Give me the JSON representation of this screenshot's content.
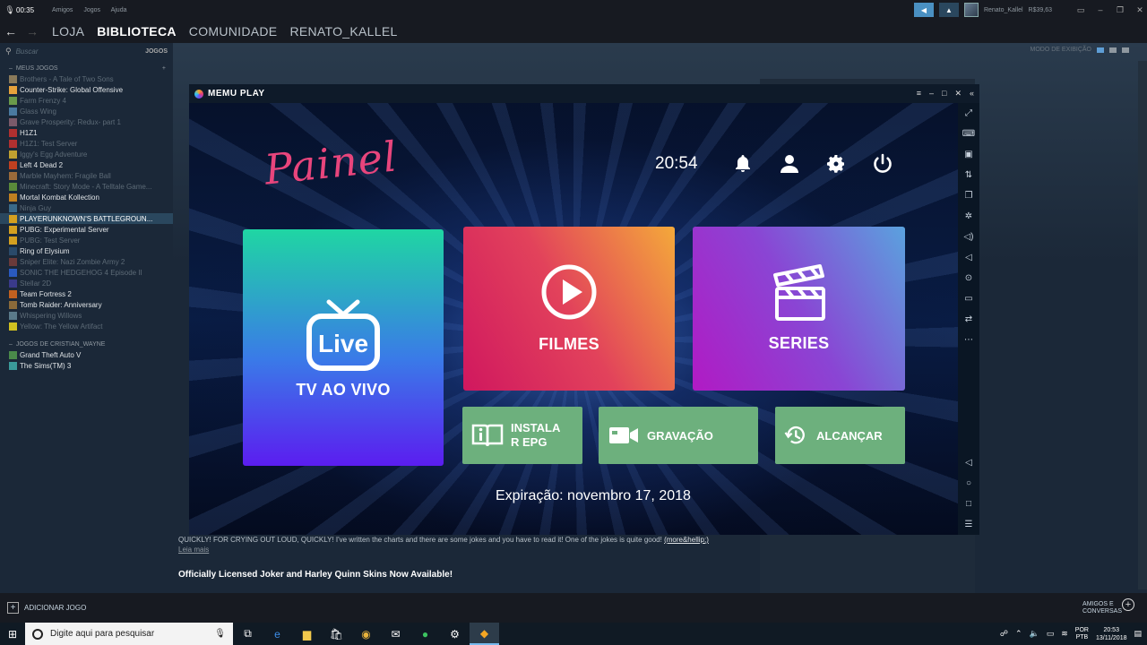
{
  "titlebar": {
    "clock": "00:35",
    "menu": [
      "Amigos",
      "Jogos",
      "Ajuda"
    ],
    "username": "Renato_Kallel",
    "wallet": "R$39,63"
  },
  "nav": {
    "items": [
      "LOJA",
      "BIBLIOTECA",
      "COMUNIDADE",
      "RENATO_KALLEL"
    ],
    "active": "BIBLIOTECA"
  },
  "sidebar": {
    "search_placeholder": "Buscar",
    "games_label": "JOGOS",
    "group1": "MEUS JOGOS",
    "games": [
      {
        "name": "Brothers - A Tale of Two Sons",
        "installed": false,
        "color": "#8a7a5a"
      },
      {
        "name": "Counter-Strike: Global Offensive",
        "installed": true,
        "color": "#e6a23c"
      },
      {
        "name": "Farm Frenzy 4",
        "installed": false,
        "color": "#6a9a4a"
      },
      {
        "name": "Glass Wing",
        "installed": false,
        "color": "#4a7aa0"
      },
      {
        "name": "Grave Prosperity: Redux- part 1",
        "installed": false,
        "color": "#7a5a6a"
      },
      {
        "name": "H1Z1",
        "installed": true,
        "color": "#b03030"
      },
      {
        "name": "H1Z1: Test Server",
        "installed": false,
        "color": "#b03030"
      },
      {
        "name": "Iggy's Egg Adventure",
        "installed": false,
        "color": "#c0a030"
      },
      {
        "name": "Left 4 Dead 2",
        "installed": true,
        "color": "#c04020"
      },
      {
        "name": "Marble Mayhem: Fragile Ball",
        "installed": false,
        "color": "#9a6a3a"
      },
      {
        "name": "Minecraft: Story Mode - A Telltale Game...",
        "installed": false,
        "color": "#5a8a3a"
      },
      {
        "name": "Mortal Kombat Kollection",
        "installed": true,
        "color": "#c08020"
      },
      {
        "name": "Ninja Guy",
        "installed": false,
        "color": "#3a6a8a"
      },
      {
        "name": "PLAYERUNKNOWN'S BATTLEGROUN...",
        "installed": true,
        "color": "#d4a020",
        "selected": true
      },
      {
        "name": "PUBG: Experimental Server",
        "installed": true,
        "color": "#d4a020"
      },
      {
        "name": "PUBG: Test Server",
        "installed": false,
        "color": "#d4a020"
      },
      {
        "name": "Ring of Elysium",
        "installed": true,
        "color": "#2a4a6a"
      },
      {
        "name": "Sniper Elite: Nazi Zombie Army 2",
        "installed": false,
        "color": "#6a3a3a"
      },
      {
        "name": "SONIC THE HEDGEHOG 4 Episode II",
        "installed": false,
        "color": "#2a5ac0"
      },
      {
        "name": "Stellar 2D",
        "installed": false,
        "color": "#3a3a8a"
      },
      {
        "name": "Team Fortress 2",
        "installed": true,
        "color": "#c06020"
      },
      {
        "name": "Tomb Raider: Anniversary",
        "installed": true,
        "color": "#8a6a3a"
      },
      {
        "name": "Whispering Willows",
        "installed": false,
        "color": "#5a7a8a"
      },
      {
        "name": "Yellow: The Yellow Artifact",
        "installed": false,
        "color": "#d0c020"
      }
    ],
    "group2": "JOGOS DE CRISTIAN_WAYNE",
    "games2": [
      {
        "name": "Grand Theft Auto V",
        "installed": true,
        "color": "#4a8a4a"
      },
      {
        "name": "The Sims(TM) 3",
        "installed": true,
        "color": "#3a9a9a"
      }
    ]
  },
  "main": {
    "view_mode": "MODO DE EXIBIÇÃO",
    "news_text": "QUICKLY! FOR CRYING OUT LOUD, QUICKLY! I've written the charts and there are some jokes and you have to read it! One of the jokes is quite good!",
    "news_more": "(more&hellip;)",
    "news_read_more": "Leia mais",
    "news_title": "Officially Licensed Joker and Harley Quinn Skins Now Available!"
  },
  "footer": {
    "add_game": "ADICIONAR JOGO",
    "friends_line1": "AMIGOS E",
    "friends_line2": "CONVERSAS"
  },
  "taskbar": {
    "search_placeholder": "Digite aqui para pesquisar",
    "lang1": "POR",
    "lang2": "PTB",
    "time": "20:53",
    "date": "13/11/2018"
  },
  "memu": {
    "title": "MEMU PLAY",
    "app": {
      "logo": "Painel",
      "clock": "20:54",
      "tiles": {
        "tv": "TV AO VIVO",
        "live": "Live",
        "filmes": "FILMES",
        "series": "SERIES",
        "epg_line1": "INSTALA",
        "epg_line2": "R EPG",
        "gravacao": "GRAVAÇÃO",
        "alcancar": "ALCANÇAR"
      },
      "expiration": "Expiração: novembro 17, 2018"
    }
  }
}
